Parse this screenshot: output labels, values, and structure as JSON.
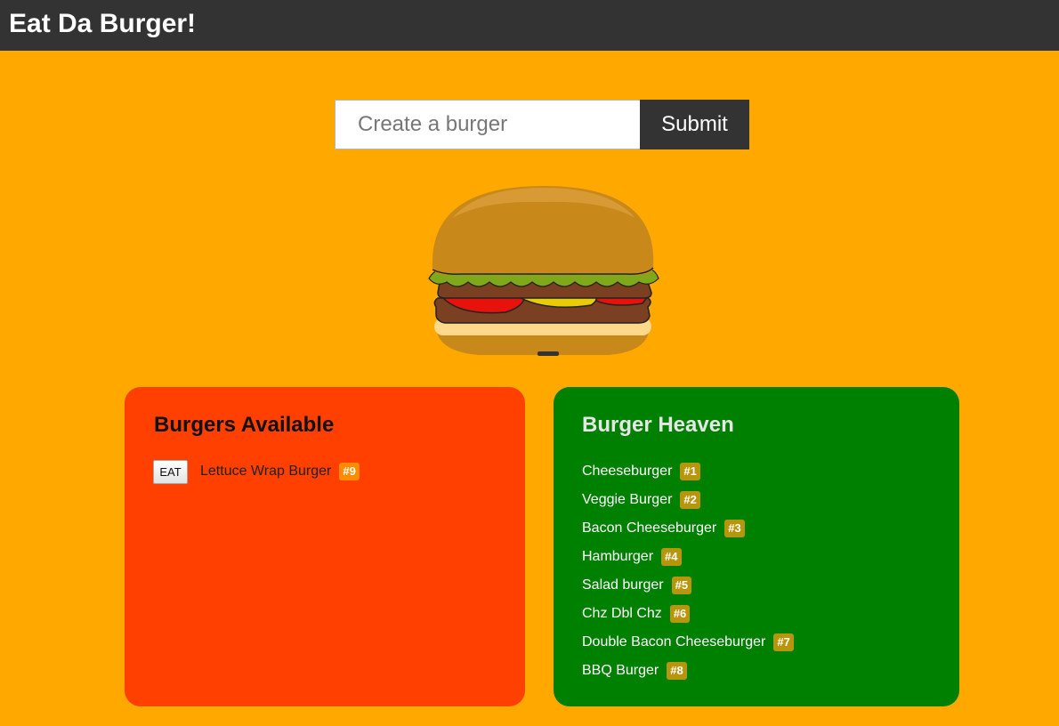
{
  "header": {
    "title": "Eat Da Burger!"
  },
  "form": {
    "placeholder": "Create a burger",
    "submit_label": "Submit"
  },
  "colors": {
    "page_background": "#ffa800",
    "header_background": "#333333",
    "available_panel": "#ff4000",
    "heaven_panel": "#008000",
    "available_badge": "#ff8c00",
    "heaven_badge": "#b8960c"
  },
  "available": {
    "title": "Burgers Available",
    "eat_label": "EAT",
    "items": [
      {
        "name": "Lettuce Wrap Burger",
        "badge": "#9"
      }
    ]
  },
  "heaven": {
    "title": "Burger Heaven",
    "items": [
      {
        "name": "Cheeseburger",
        "badge": "#1"
      },
      {
        "name": "Veggie Burger",
        "badge": "#2"
      },
      {
        "name": "Bacon Cheeseburger",
        "badge": "#3"
      },
      {
        "name": "Hamburger",
        "badge": "#4"
      },
      {
        "name": "Salad burger",
        "badge": "#5"
      },
      {
        "name": "Chz Dbl Chz",
        "badge": "#6"
      },
      {
        "name": "Double Bacon Cheeseburger",
        "badge": "#7"
      },
      {
        "name": "BBQ Burger",
        "badge": "#8"
      }
    ]
  }
}
